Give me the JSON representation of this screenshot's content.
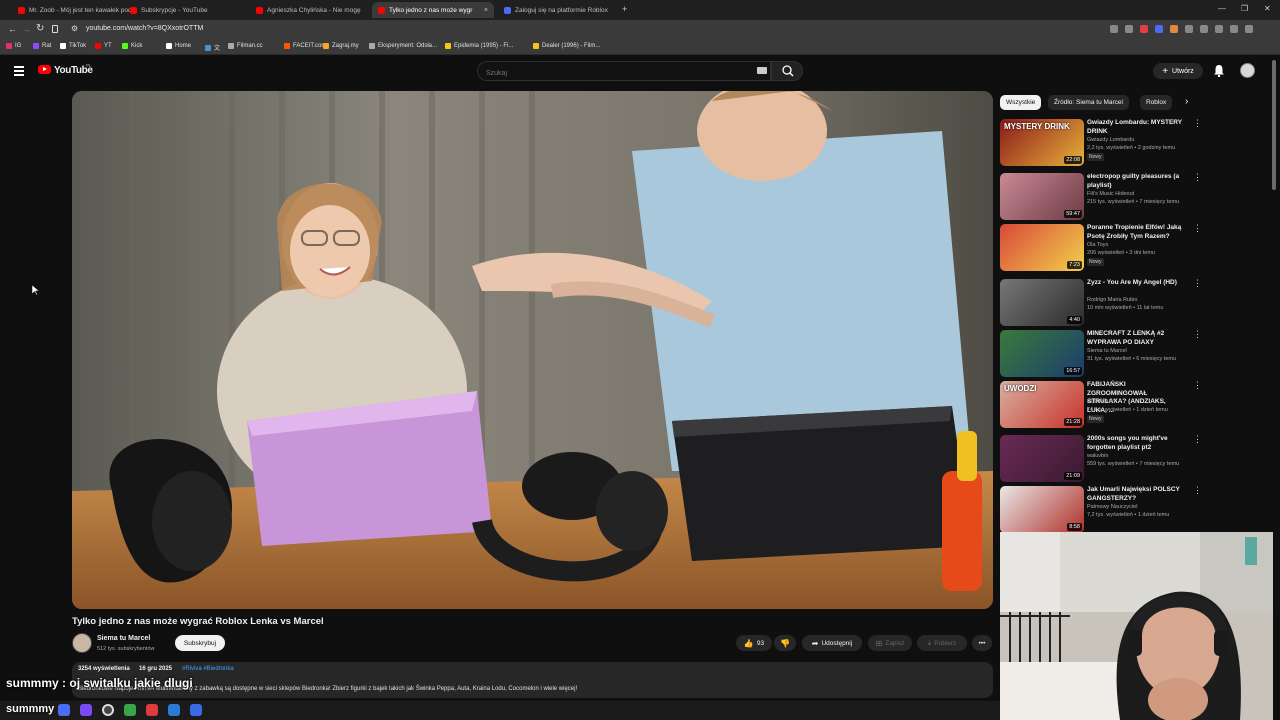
{
  "browser": {
    "tabs": [
      {
        "label": "Mr. Zoob - Mój jest ten kawałek podł",
        "color": "#ff0000"
      },
      {
        "label": "Subskrypcje - YouTube",
        "color": "#ff0000"
      },
      {
        "label": "Agnieszka Chylińska - Nie mogę",
        "color": "#ff0000"
      },
      {
        "label": "Tylko jedno z nas może wygr",
        "color": "#ff0000",
        "active": true
      },
      {
        "label": "Zaloguj się na platformie Roblox",
        "color": "#4a6cf7"
      }
    ],
    "new_tab": "+",
    "url": "youtube.com/watch?v=8QXxotrOTTM",
    "window_controls": [
      "—",
      "❐",
      "✕"
    ],
    "bookmarks": [
      {
        "label": "IG",
        "color": "#e1306c"
      },
      {
        "label": "Rat",
        "color": "#9146ff"
      },
      {
        "label": "TikTok",
        "color": "#ffffff"
      },
      {
        "label": "YT",
        "color": "#ff0000"
      },
      {
        "label": "Kick",
        "color": "#53fc18"
      },
      {
        "label": "Home",
        "color": "#ffffff"
      },
      {
        "label": "文",
        "color": "#4a90e2"
      },
      {
        "label": "Filman.cc",
        "color": "#aaaaaa"
      },
      {
        "label": "FACEIT.com",
        "color": "#ff5500"
      },
      {
        "label": "Zagraj.my",
        "color": "#f5a623"
      },
      {
        "label": "Eksperyment: Odsła...",
        "color": "#aaaaaa"
      },
      {
        "label": "Epidemia (1995) - Fi...",
        "color": "#f5c518"
      },
      {
        "label": "Dealer (1996) - Film...",
        "color": "#f5c518"
      }
    ]
  },
  "header": {
    "logo_text": "YouTube",
    "logo_region": "PL",
    "search_placeholder": "Szukaj",
    "create_label": "Utwórz"
  },
  "video": {
    "title": "Tylko jedno z nas może wygrać Roblox Lenka vs Marcel",
    "channel": "Siema tu Marcel",
    "subscribers": "512 tys. subskrybentów",
    "subscribe_label": "Subskrybuj",
    "likes": "93",
    "share_label": "Udostępnij",
    "save_label": "Zapisz",
    "download_label": "Pobierz",
    "views": "3254 wyświetlenia",
    "date": "16 gru 2025",
    "hashtags": "#Riviva #Biedronka",
    "description": "Biedronkowe Napoje RIVIVA MultiWitaminy z zabawką są dostępne w sieci sklepów Biedronka! Zbierz figurki z bajek takich jak Świnka Peppa, Auta, Kraina Lodu, Cocomelon i wiele więcej!"
  },
  "sidebar": {
    "chips": [
      "Wszystkie",
      "Źródło: Siema tu Marcel",
      "Roblox"
    ],
    "recommendations": [
      {
        "title": "Gwiazdy Lombardu: MYSTERY DRINK",
        "channel": "Gwiazdy Lombardu",
        "meta": "2,2 tys. wyświetleń • 2 godziny temu",
        "badge": "Nowy",
        "duration": "22:08",
        "thumb_text": "MYSTERY DRINK",
        "c1": "#8b1a1a",
        "c2": "#e8b13a"
      },
      {
        "title": "electropop guilty pleasures (a playlist)",
        "channel": "Fili's Music Hideout",
        "meta": "215 tys. wyświetleń • 7 miesięcy temu",
        "badge": "",
        "duration": "59:47",
        "thumb_text": "",
        "c1": "#c98a95",
        "c2": "#6e3b46"
      },
      {
        "title": "Poranne Tropienie Elfów! Jaką Psotę Zrobiły Tym Razem?",
        "channel": "Ola Toys",
        "meta": "206 wyświetleń • 3 dni temu",
        "badge": "Nowy",
        "duration": "7:23",
        "thumb_text": "",
        "c1": "#d84a3a",
        "c2": "#f2d04b"
      },
      {
        "title": "Zyzz - You Are My Angel (HD)",
        "channel": "Rodrigo Maria Rubio",
        "meta": "10 mln wyświetleń • 11 lat temu",
        "badge": "",
        "duration": "4:40",
        "thumb_text": "",
        "c1": "#777777",
        "c2": "#2c2c2c"
      },
      {
        "title": "MINECRAFT Z LENKĄ #2 WYPRAWA PO DIAXY",
        "channel": "Siema tu Marcel",
        "meta": "31 tys. wyświetleń • 6 miesięcy temu",
        "badge": "",
        "duration": "16:57",
        "thumb_text": "",
        "c1": "#3a7a3a",
        "c2": "#1c3d6e"
      },
      {
        "title": "FABIJAŃSKI ZGROOMINGOWAŁ STRULAXA? (ANDZIAKS, LUKA, ...",
        "channel": "PLOTKARY",
        "meta": "74 tys. wyświetleń • 1 dzień temu",
        "badge": "Nowy",
        "duration": "21:28",
        "thumb_text": "UWODZI",
        "c1": "#d8b0a0",
        "c2": "#c8322a"
      },
      {
        "title": "2000s songs you might've forgotten playlist pt2",
        "channel": "waluvbin",
        "meta": "559 tys. wyświetleń • 7 miesięcy temu",
        "badge": "",
        "duration": "21:09",
        "thumb_text": "",
        "c1": "#6a2a55",
        "c2": "#3a1a30"
      },
      {
        "title": "Jak Umarli Najwięksi POLSCY GANGSTERZY?",
        "channel": "Palmowy Nauczyciel",
        "meta": "7,2 tys. wyświetleń • 1 dzień temu",
        "badge": "",
        "duration": "8:58",
        "thumb_text": "",
        "c1": "#e8e8e8",
        "c2": "#b0302a"
      }
    ]
  },
  "chat": {
    "username": "summmy",
    "message": "oj switalku jakie dlugi",
    "watermark": "summmy"
  }
}
